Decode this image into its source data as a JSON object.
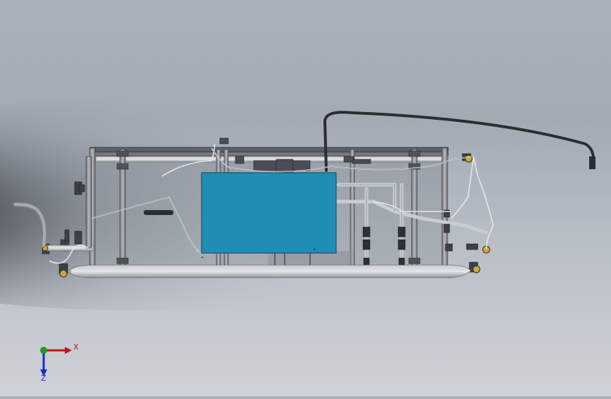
{
  "triad": {
    "x_label": "X",
    "z_label": "Z",
    "x_color": "#c0141c",
    "y_color": "#1c9c24",
    "z_color": "#1a2cc8"
  },
  "panel": {
    "color": "#1f8db5"
  }
}
